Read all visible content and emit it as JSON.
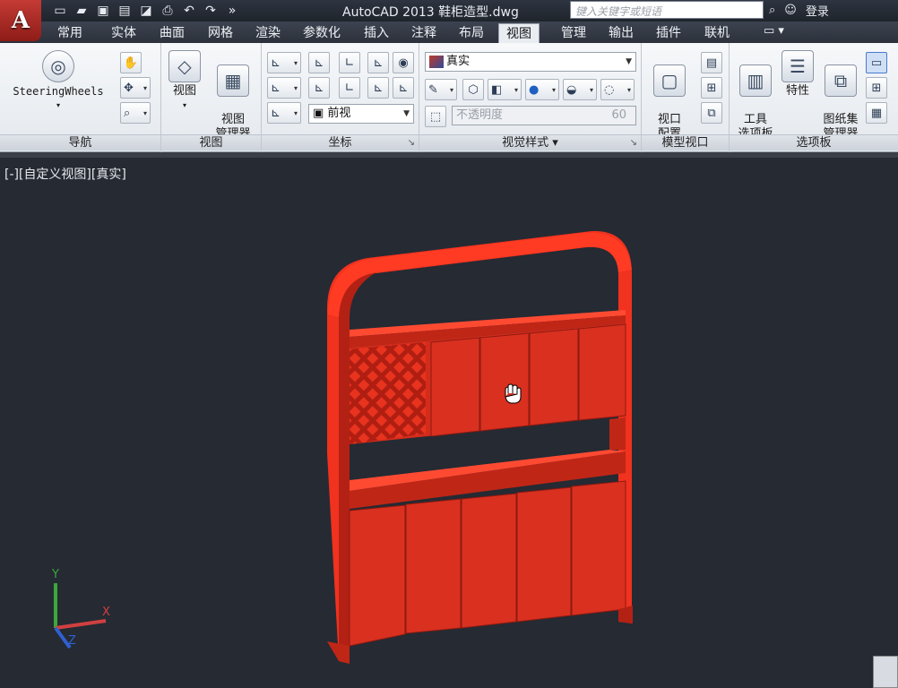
{
  "app": {
    "logo_letter": "A",
    "title": "AutoCAD 2013    鞋柜造型.dwg",
    "search_placeholder": "键入关键字或短语",
    "login_label": "登录"
  },
  "quick_access": [
    "new-icon",
    "open-icon",
    "save-icon",
    "saveas-icon",
    "plot-preview-icon",
    "print-icon",
    "undo-icon",
    "redo-icon",
    "more-icon"
  ],
  "tabs": [
    {
      "label": "常用",
      "active": false
    },
    {
      "label": "实体",
      "active": false
    },
    {
      "label": "曲面",
      "active": false
    },
    {
      "label": "网格",
      "active": false
    },
    {
      "label": "渲染",
      "active": false
    },
    {
      "label": "参数化",
      "active": false
    },
    {
      "label": "插入",
      "active": false
    },
    {
      "label": "注释",
      "active": false
    },
    {
      "label": "布局",
      "active": false
    },
    {
      "label": "视图",
      "active": true
    },
    {
      "label": "管理",
      "active": false
    },
    {
      "label": "输出",
      "active": false
    },
    {
      "label": "插件",
      "active": false
    },
    {
      "label": "联机",
      "active": false
    }
  ],
  "ribbon": {
    "nav": {
      "steering_label": "SteeringWheels",
      "panel_label": "导航"
    },
    "view": {
      "view_label": "视图",
      "manager_label": "视图\n管理器",
      "panel_label": "视图"
    },
    "coords": {
      "view_combo": "前视",
      "panel_label": "坐标"
    },
    "visual": {
      "style_combo": "真实",
      "opacity_label": "不透明度",
      "opacity_value": "60",
      "panel_label": "视觉样式 ▾"
    },
    "viewports": {
      "config_label": "视口\n配置",
      "panel_label": "模型视口"
    },
    "palettes": {
      "tools_label": "工具\n选项板",
      "props_label": "特性",
      "sheetset_label": "图纸集\n管理器",
      "panel_label": "选项板"
    }
  },
  "viewport": {
    "label": "[-][自定义视图][真实]",
    "model_color": "#d93020",
    "background": "#252a33"
  },
  "ucs": {
    "x": "X",
    "y": "Y",
    "z": "Z"
  }
}
